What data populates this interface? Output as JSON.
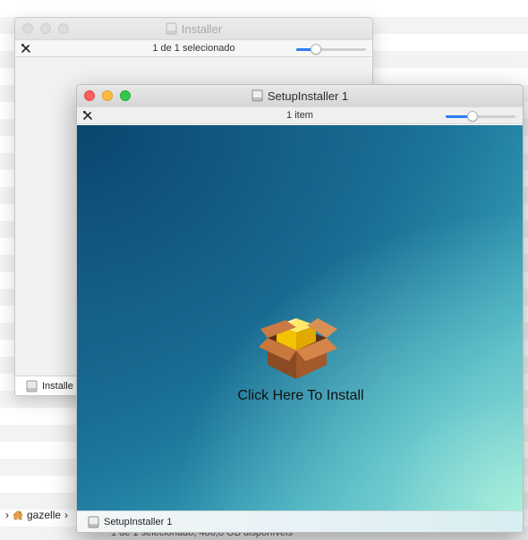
{
  "background_window": {
    "path": {
      "chevron": "›",
      "home_label": "gazelle",
      "sep": "›"
    },
    "status": "1 de 1 selecionado, 486,8 GB disponíveis"
  },
  "back_window": {
    "title": "Installer",
    "toolbar_status": "1 de 1 selecionado",
    "footer_item": "Installe",
    "icon_size_level": 0.28
  },
  "front_window": {
    "title": "SetupInstaller 1",
    "toolbar_status": "1 item",
    "install_label": "Click Here To Install",
    "footer_item": "SetupInstaller 1",
    "icon_size_level": 0.38
  },
  "icons": {
    "disk": "disk-icon",
    "tools": "tools-icon",
    "package": "package-icon",
    "home": "home-icon"
  },
  "colors": {
    "accent": "#2e7cf6",
    "close": "#fc605c",
    "minimize": "#fdbc40",
    "zoom": "#34c84a"
  }
}
